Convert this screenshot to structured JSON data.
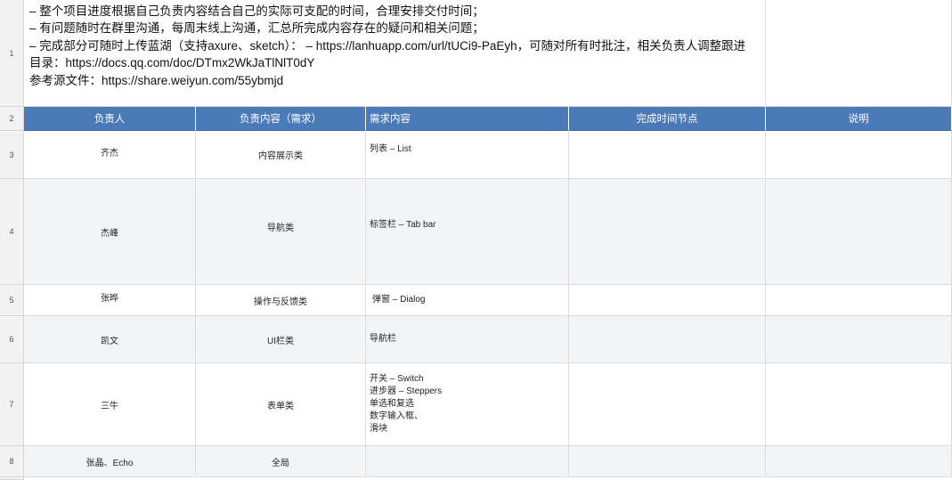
{
  "notes": {
    "line1": "– 整个项目进度根据自己负责内容结合自己的实际可支配的时间，合理安排交付时间；",
    "line2": "– 有问题随时在群里沟通，每周末线上沟通，汇总所完成内容存在的疑问和相关问题；",
    "line3": "– 完成部分可随时上传蓝湖（支持axure、sketch）： – https://lanhuapp.com/url/tUCi9-PaEyh，可随对所有时批注，相关负责人调整跟进",
    "line4": "目录：https://docs.qq.com/doc/DTmx2WkJaTlNlT0dY",
    "line5": "参考源文件：https://share.weiyun.com/55ybmjd"
  },
  "row_numbers": [
    "1",
    "2",
    "3",
    "4",
    "5",
    "6",
    "7",
    "8"
  ],
  "headers": {
    "owner": "负责人",
    "content": "负责内容（需求）",
    "requirement": "需求内容",
    "deadline": "完成时间节点",
    "remarks": "说明"
  },
  "rows": [
    {
      "owner": "齐杰",
      "content": "内容展示类",
      "requirement": [
        "列表 – List"
      ]
    },
    {
      "owner": "杰峰",
      "content": "导航类",
      "requirement": [
        "标签栏 – Tab bar"
      ]
    },
    {
      "owner": "张晔",
      "content": "操作与反馈类",
      "requirement": [
        "弹窗 – Dialog"
      ]
    },
    {
      "owner": "凯文",
      "content": "UI栏类",
      "requirement": [
        "导航栏"
      ]
    },
    {
      "owner": "三牛",
      "content": "表单类",
      "requirement": [
        "开关 – Switch",
        "进步器 – Steppers",
        "单选和复选",
        "数字输入框、",
        "滑块"
      ]
    },
    {
      "owner": "张晶、Echo",
      "content": "全局",
      "requirement": []
    }
  ],
  "colors": {
    "header_bg": "#4a7ab8",
    "header_text": "#ffffff",
    "row_shade": "#f3f4f6"
  }
}
